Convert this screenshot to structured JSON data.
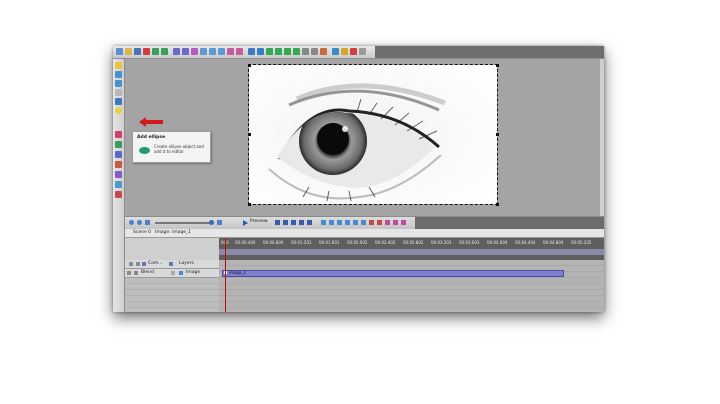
{
  "tooltip": {
    "title": "Add ellipse",
    "description": "Create ellipse object and add it to editor",
    "icon": "ellipse-icon"
  },
  "player": {
    "preview_label": "Preview",
    "controls": [
      "zoom-out-icon",
      "zoom-in-icon",
      "zoom-fit-icon",
      "preview-play-icon",
      "skip-start-icon",
      "step-back-icon",
      "step-forward-icon",
      "skip-end-icon"
    ]
  },
  "timeline": {
    "tabs": [
      "Scene 0",
      "Image: image_1"
    ],
    "time_ticks": [
      "000",
      "00:00.400",
      "00:00.800",
      "00:01.201",
      "00:01.601",
      "00:02.002",
      "00:02.402",
      "00:02.802",
      "00:03.203",
      "00:03.603",
      "00:04.004",
      "00:04.404",
      "00:04.804",
      "00:05.205"
    ],
    "header": {
      "com_label": "Com...",
      "layers_label": "Layers"
    },
    "track": {
      "blend_label": "Blend",
      "layer_label": "Image"
    },
    "clip_label": "image_1"
  },
  "colors": {
    "window_bg": "#a3a3a3",
    "clip_fill": "#7f7fd2",
    "playhead": "#d10000",
    "arrow": "#d11a1a",
    "tooltip_icon": "#1f9e63"
  }
}
